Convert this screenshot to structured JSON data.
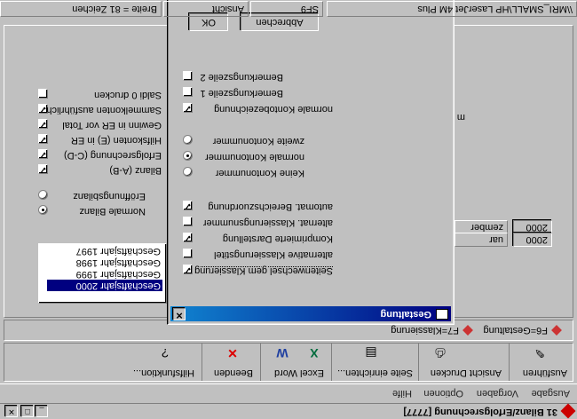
{
  "window": {
    "title": "31 Bilanz/Erfolgsrechnung [7777]"
  },
  "menu": [
    "Ausgabe",
    "Vorgaben",
    "Optionen",
    "Hilfe"
  ],
  "toolbar": {
    "groups": [
      {
        "label": "Ausführen",
        "icon": "pen-icon"
      },
      {
        "label": "Ansicht  Drucken",
        "icon": "printer-icon"
      },
      {
        "label": "Seite einrichten...",
        "icon": "page-setup-icon"
      },
      {
        "label": "Excel  Word",
        "icon": "excel-word-icon"
      },
      {
        "label": "Beenden",
        "icon": "exit-icon"
      },
      {
        "label": "Hilfsfunktion...",
        "icon": "help-icon"
      }
    ]
  },
  "shortcuts": [
    "F6=Gestaltung",
    "F7=Klassierung"
  ],
  "left_options": {
    "checkboxes": [
      {
        "label": "Saldi 0 drucken",
        "checked": false
      },
      {
        "label": "Sammelkonten ausführlich",
        "checked": true
      },
      {
        "label": "Gewinn in ER vor Total",
        "checked": true
      },
      {
        "label": "Hilfskonten (E) in ER",
        "checked": true
      },
      {
        "label": "Erfolgsrechnung (C-D)",
        "checked": true
      },
      {
        "label": "Bilanz (A-B)",
        "checked": true
      }
    ],
    "radios": [
      {
        "label": "Eröffnungsbilanz",
        "checked": false
      },
      {
        "label": "Normale Bilanz",
        "checked": true
      }
    ],
    "years": [
      {
        "label": "Geschäftsjahr 1997",
        "selected": false
      },
      {
        "label": "Geschäftsjahr 1998",
        "selected": false
      },
      {
        "label": "Geschäftsjahr 1999",
        "selected": false
      },
      {
        "label": "Geschäftsjahr 2000",
        "selected": true
      }
    ]
  },
  "right_fields": {
    "partial_m": "m",
    "dez_label": "zember",
    "dez_value": "2000",
    "jan_label": "uar",
    "jan_value": "2000"
  },
  "dialog": {
    "title": "Gestaltung",
    "ok": "OK",
    "cancel": "Abbrechen",
    "checks_top": [
      {
        "label": "Bemerkungszeile 2",
        "checked": false
      },
      {
        "label": "Bemerkungszeile 1",
        "checked": false
      },
      {
        "label": "normale Kontobezeichnung",
        "checked": true
      }
    ],
    "radios": [
      {
        "label": "zweite Kontonummer",
        "checked": false
      },
      {
        "label": "normale Kontonummer",
        "checked": true
      },
      {
        "label": "Keine Kontonummer",
        "checked": false
      }
    ],
    "checks_bottom": [
      {
        "label": "automat. Bereichszuordnung",
        "checked": true
      },
      {
        "label": "alternat. Klassierungsnummer",
        "checked": false
      },
      {
        "label": "Komprimierte Darstellung",
        "checked": true
      },
      {
        "label": "alternative Klassierungstitel",
        "checked": false
      },
      {
        "label": "Seitenwechsel gem Klassierung",
        "checked": true
      }
    ]
  },
  "status": {
    "field1": "Breite = 81 Zeichen",
    "field2": "Ansicht",
    "field3": "SF9",
    "field4": "\\\\MRI_SMALL\\HP LaserJet 4M Plus"
  }
}
